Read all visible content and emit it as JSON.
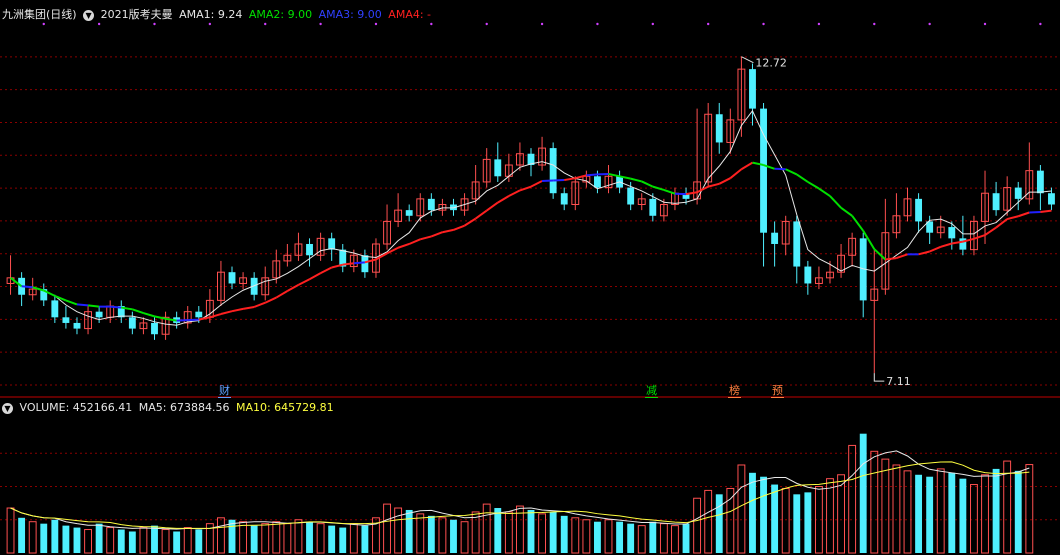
{
  "header": {
    "stock_name": "九洲集团(日线)",
    "indicator_name": "2021版考夫曼",
    "ama1_label": "AMA1: 9.24",
    "ama2_label": "AMA2: 9.00",
    "ama3_label": "AMA3: 9.00",
    "ama4_label": "AMA4: -"
  },
  "volume_header": {
    "volume_label": "VOLUME: 452166.41",
    "ma5_label": "MA5: 673884.56",
    "ma10_label": "MA10: 645729.81"
  },
  "markers": {
    "cai": "财",
    "jian": "减",
    "bang": "榜",
    "yu": "预"
  },
  "annotations": {
    "high_label": "12.72",
    "low_label": "7.11"
  },
  "colors": {
    "up": "#ff5050",
    "down": "#4ff0ff",
    "ama_up": "#ff2020",
    "ama_flat": "#2020ff",
    "ama_down": "#00e000",
    "ma_white": "#e8e8e8",
    "ma_yellow": "#ffff40",
    "grid": "#8a0000"
  },
  "chart_data": {
    "type": "candlestick",
    "price_range": [
      6.9,
      13.3
    ],
    "high": 12.72,
    "low": 7.11,
    "candles": [
      [
        8.7,
        8.8,
        9.2,
        8.5
      ],
      [
        8.8,
        8.5,
        8.9,
        8.3
      ],
      [
        8.5,
        8.6,
        8.8,
        8.4
      ],
      [
        8.6,
        8.4,
        8.7,
        8.3
      ],
      [
        8.4,
        8.1,
        8.5,
        8.0
      ],
      [
        8.1,
        8.0,
        8.3,
        7.9
      ],
      [
        8.0,
        7.9,
        8.1,
        7.8
      ],
      [
        7.9,
        8.2,
        8.3,
        7.8
      ],
      [
        8.2,
        8.1,
        8.3,
        8.0
      ],
      [
        8.1,
        8.3,
        8.4,
        8.0
      ],
      [
        8.3,
        8.1,
        8.4,
        8.0
      ],
      [
        8.1,
        7.9,
        8.2,
        7.8
      ],
      [
        7.9,
        8.0,
        8.1,
        7.8
      ],
      [
        8.0,
        7.8,
        8.1,
        7.7
      ],
      [
        7.8,
        8.1,
        8.2,
        7.7
      ],
      [
        8.1,
        8.0,
        8.2,
        7.9
      ],
      [
        8.0,
        8.2,
        8.3,
        7.9
      ],
      [
        8.2,
        8.1,
        8.3,
        8.0
      ],
      [
        8.1,
        8.4,
        8.6,
        8.0
      ],
      [
        8.4,
        8.9,
        9.1,
        8.3
      ],
      [
        8.9,
        8.7,
        9.0,
        8.6
      ],
      [
        8.7,
        8.8,
        8.9,
        8.6
      ],
      [
        8.8,
        8.5,
        8.9,
        8.4
      ],
      [
        8.5,
        8.8,
        9.0,
        8.4
      ],
      [
        8.8,
        9.1,
        9.3,
        8.7
      ],
      [
        9.1,
        9.2,
        9.4,
        9.0
      ],
      [
        9.2,
        9.4,
        9.6,
        9.1
      ],
      [
        9.4,
        9.2,
        9.5,
        9.0
      ],
      [
        9.2,
        9.5,
        9.6,
        9.1
      ],
      [
        9.5,
        9.3,
        9.6,
        9.1
      ],
      [
        9.3,
        9.0,
        9.4,
        8.9
      ],
      [
        9.0,
        9.2,
        9.3,
        8.9
      ],
      [
        9.2,
        8.9,
        9.3,
        8.8
      ],
      [
        8.9,
        9.4,
        9.5,
        8.8
      ],
      [
        9.4,
        9.8,
        10.1,
        9.3
      ],
      [
        9.8,
        10.0,
        10.3,
        9.7
      ],
      [
        10.0,
        9.9,
        10.1,
        9.8
      ],
      [
        9.9,
        10.2,
        10.3,
        9.8
      ],
      [
        10.2,
        10.0,
        10.3,
        9.9
      ],
      [
        10.0,
        10.1,
        10.2,
        9.9
      ],
      [
        10.1,
        10.0,
        10.2,
        9.9
      ],
      [
        10.0,
        10.2,
        10.3,
        9.9
      ],
      [
        10.2,
        10.5,
        10.8,
        10.1
      ],
      [
        10.5,
        10.9,
        11.1,
        10.4
      ],
      [
        10.9,
        10.6,
        11.2,
        10.5
      ],
      [
        10.6,
        10.8,
        11.0,
        10.5
      ],
      [
        10.8,
        11.0,
        11.2,
        10.7
      ],
      [
        11.0,
        10.8,
        11.1,
        10.6
      ],
      [
        10.8,
        11.1,
        11.3,
        10.7
      ],
      [
        11.1,
        10.3,
        11.2,
        10.2
      ],
      [
        10.3,
        10.1,
        10.4,
        10.0
      ],
      [
        10.1,
        10.5,
        10.6,
        10.0
      ],
      [
        10.5,
        10.6,
        10.7,
        10.4
      ],
      [
        10.6,
        10.4,
        10.7,
        10.3
      ],
      [
        10.4,
        10.6,
        10.8,
        10.3
      ],
      [
        10.6,
        10.4,
        10.7,
        10.3
      ],
      [
        10.4,
        10.1,
        10.5,
        10.0
      ],
      [
        10.1,
        10.2,
        10.3,
        10.0
      ],
      [
        10.2,
        9.9,
        10.3,
        9.8
      ],
      [
        9.9,
        10.1,
        10.2,
        9.8
      ],
      [
        10.1,
        10.3,
        10.4,
        10.0
      ],
      [
        10.3,
        10.2,
        10.4,
        10.1
      ],
      [
        10.2,
        10.5,
        11.8,
        10.1
      ],
      [
        10.5,
        11.7,
        11.9,
        10.4
      ],
      [
        11.7,
        11.2,
        11.9,
        11.0
      ],
      [
        11.2,
        11.6,
        11.8,
        11.0
      ],
      [
        11.6,
        12.5,
        12.72,
        11.3
      ],
      [
        12.5,
        11.8,
        12.6,
        11.5
      ],
      [
        11.8,
        9.6,
        11.9,
        9.0
      ],
      [
        9.6,
        9.4,
        9.8,
        9.0
      ],
      [
        9.4,
        9.8,
        9.9,
        9.2
      ],
      [
        9.8,
        9.0,
        9.9,
        8.7
      ],
      [
        9.0,
        8.7,
        9.1,
        8.5
      ],
      [
        8.7,
        8.8,
        9.0,
        8.6
      ],
      [
        8.8,
        8.9,
        9.1,
        8.7
      ],
      [
        8.9,
        9.2,
        9.4,
        8.8
      ],
      [
        9.2,
        9.5,
        9.6,
        9.0
      ],
      [
        9.5,
        8.4,
        9.6,
        8.1
      ],
      [
        8.4,
        8.6,
        9.3,
        7.11
      ],
      [
        8.6,
        9.6,
        10.2,
        8.5
      ],
      [
        9.6,
        9.9,
        10.3,
        9.5
      ],
      [
        9.9,
        10.2,
        10.4,
        9.8
      ],
      [
        10.2,
        9.8,
        10.3,
        9.6
      ],
      [
        9.8,
        9.6,
        9.9,
        9.4
      ],
      [
        9.6,
        9.7,
        9.9,
        9.5
      ],
      [
        9.7,
        9.5,
        9.8,
        9.3
      ],
      [
        9.5,
        9.3,
        9.9,
        9.2
      ],
      [
        9.3,
        9.8,
        9.9,
        9.2
      ],
      [
        9.8,
        10.3,
        10.7,
        9.4
      ],
      [
        10.3,
        10.0,
        10.5,
        9.9
      ],
      [
        10.0,
        10.4,
        10.6,
        9.9
      ],
      [
        10.4,
        10.2,
        10.5,
        10.0
      ],
      [
        10.2,
        10.7,
        11.2,
        10.1
      ],
      [
        10.7,
        10.3,
        10.8,
        10.0
      ],
      [
        10.3,
        10.1,
        10.4,
        10.0
      ]
    ],
    "volume_range": [
      0,
      680000
    ],
    "volumes": [
      230000,
      180000,
      160000,
      150000,
      170000,
      140000,
      130000,
      120000,
      150000,
      130000,
      120000,
      110000,
      130000,
      140000,
      120000,
      110000,
      130000,
      120000,
      150000,
      180000,
      170000,
      160000,
      140000,
      150000,
      160000,
      150000,
      170000,
      160000,
      150000,
      140000,
      130000,
      150000,
      140000,
      180000,
      250000,
      230000,
      220000,
      200000,
      190000,
      180000,
      170000,
      160000,
      210000,
      250000,
      230000,
      210000,
      240000,
      220000,
      200000,
      210000,
      190000,
      180000,
      170000,
      160000,
      170000,
      160000,
      150000,
      140000,
      160000,
      150000,
      140000,
      150000,
      280000,
      320000,
      300000,
      330000,
      450000,
      410000,
      390000,
      350000,
      330000,
      300000,
      310000,
      340000,
      380000,
      400000,
      550000,
      610000,
      520000,
      480000,
      450000,
      420000,
      400000,
      390000,
      430000,
      410000,
      380000,
      350000,
      400000,
      430000,
      470000,
      420000,
      452166
    ]
  }
}
